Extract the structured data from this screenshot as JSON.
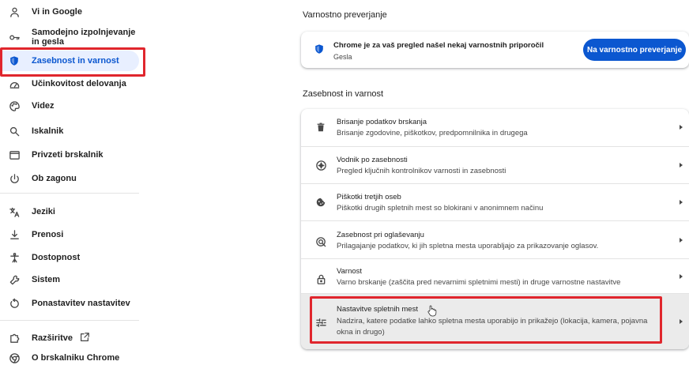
{
  "sidebar": {
    "items": [
      {
        "label": "Vi in Google",
        "icon": "person-icon"
      },
      {
        "label": "Samodejno izpolnjevanje in gesla",
        "icon": "key-icon"
      },
      {
        "label": "Zasebnost in varnost",
        "icon": "shield-icon"
      },
      {
        "label": "Učinkovitost delovanja",
        "icon": "speedometer-icon"
      },
      {
        "label": "Videz",
        "icon": "palette-icon"
      },
      {
        "label": "Iskalnik",
        "icon": "search-icon"
      },
      {
        "label": "Privzeti brskalnik",
        "icon": "browser-window-icon"
      },
      {
        "label": "Ob zagonu",
        "icon": "power-icon"
      },
      {
        "label": "Jeziki",
        "icon": "translate-icon"
      },
      {
        "label": "Prenosi",
        "icon": "download-icon"
      },
      {
        "label": "Dostopnost",
        "icon": "accessibility-icon"
      },
      {
        "label": "Sistem",
        "icon": "wrench-icon"
      },
      {
        "label": "Ponastavitev nastavitev",
        "icon": "reset-icon"
      },
      {
        "label": "Razširitve",
        "icon": "puzzle-icon"
      },
      {
        "label": "O brskalniku Chrome",
        "icon": "chrome-icon"
      }
    ],
    "active_index": 2
  },
  "safety_check": {
    "section_title": "Varnostno preverjanje",
    "title": "Chrome je za vaš pregled našel nekaj varnostnih priporočil",
    "subtitle": "Gesla",
    "button_label": "Na varnostno preverjanje"
  },
  "privacy": {
    "section_title": "Zasebnost in varnost",
    "rows": [
      {
        "title": "Brisanje podatkov brskanja",
        "subtitle": "Brisanje zgodovine, piškotkov, predpomnilnika in drugega",
        "icon": "trash-icon"
      },
      {
        "title": "Vodnik po zasebnosti",
        "subtitle": "Pregled ključnih kontrolnikov varnosti in zasebnosti",
        "icon": "compass-icon"
      },
      {
        "title": "Piškotki tretjih oseb",
        "subtitle": "Piškotki drugih spletnih mest so blokirani v anonimnem načinu",
        "icon": "cookie-icon"
      },
      {
        "title": "Zasebnost pri oglaševanju",
        "subtitle": "Prilagajanje podatkov, ki jih spletna mesta uporabljajo za prikazovanje oglasov.",
        "icon": "ad-privacy-icon"
      },
      {
        "title": "Varnost",
        "subtitle": "Varno brskanje (zaščita pred nevarnimi spletnimi mesti) in druge varnostne nastavitve",
        "icon": "lock-icon"
      },
      {
        "title": "Nastavitve spletnih mest",
        "subtitle_line1": "Nadzira, katere podatke lahko spletna mesta uporabijo in prikažejo (lokacija, kamera, pojavna",
        "subtitle_line2": "okna in drugo)",
        "icon": "sliders-icon"
      }
    ]
  },
  "colors": {
    "accent": "#0b57d0",
    "highlight_box": "#e0262d",
    "active_bg": "#e8efff"
  }
}
